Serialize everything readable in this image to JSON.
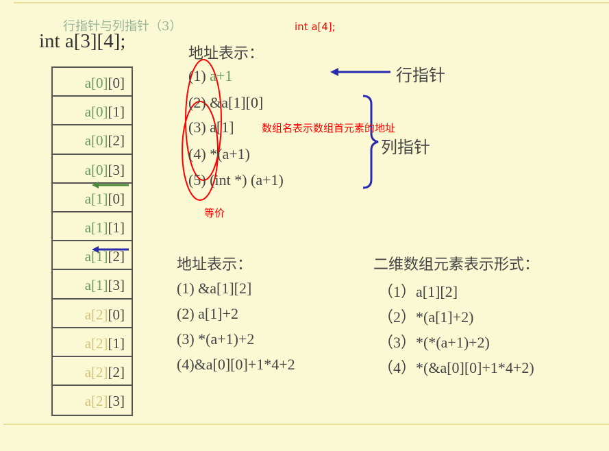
{
  "slide": {
    "title": "行指针与列指针（3）",
    "declaration": "int  a[3][4];",
    "cells": [
      {
        "pre": "a[0]",
        "suf": "[0]"
      },
      {
        "pre": "a[0]",
        "suf": "[1]"
      },
      {
        "pre": "a[0]",
        "suf": "[2]"
      },
      {
        "pre": "a[0]",
        "suf": "[3]"
      },
      {
        "pre": "a[1]",
        "suf": "[0]"
      },
      {
        "pre": "a[1]",
        "suf": "[1]"
      },
      {
        "pre": "a[1]",
        "suf": "[2]"
      },
      {
        "pre": "a[1]",
        "suf": "[3]"
      },
      {
        "pre": "a[2]",
        "suf": "[0]"
      },
      {
        "pre": "a[2]",
        "suf": "[1]"
      },
      {
        "pre": "a[2]",
        "suf": "[2]"
      },
      {
        "pre": "a[2]",
        "suf": "[3]"
      }
    ],
    "top_block": {
      "heading": "地址表示：",
      "items": [
        {
          "num": "(1)",
          "expr": "a+1"
        },
        {
          "num": "(2)",
          "expr": "&a[1][0]"
        },
        {
          "num": "(3)",
          "expr": "a[1]"
        },
        {
          "num": "(4)",
          "expr": "*(a+1)"
        },
        {
          "num": "(5)",
          "expr": "(int  *) (a+1)"
        }
      ],
      "row_pointer_label": "行指针",
      "column_pointer_label": "列指针"
    },
    "bottom_left": {
      "heading": "地址表示：",
      "items": [
        "(1)  &a[1][2]",
        "(2) a[1]+2",
        "(3) *(a+1)+2",
        "(4)&a[0][0]+1*4+2"
      ]
    },
    "bottom_right": {
      "heading": "二维数组元素表示形式：",
      "items": [
        "（1）a[1][2]",
        "（2）*(a[1]+2)",
        "（3）*(*(a+1)+2)",
        "（4）*(&a[0][0]+1*4+2)"
      ]
    }
  },
  "annotations": {
    "top_note": "int a[4];",
    "array_name_note": "数组名表示数组首元素的地址",
    "equivalent_note": "等价"
  },
  "colors": {
    "background": "#fbf9d3",
    "annotation": "#ff0000",
    "row_arrow": "#2a2ab0",
    "green": "#6a9a62"
  }
}
